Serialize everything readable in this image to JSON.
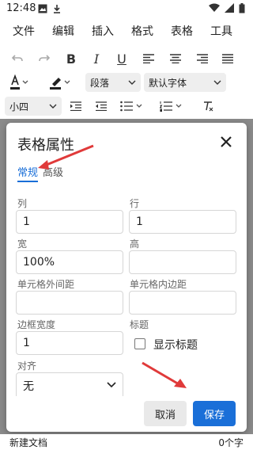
{
  "status": {
    "time": "12:48"
  },
  "menu": [
    "文件",
    "编辑",
    "插入",
    "格式",
    "表格",
    "工具"
  ],
  "toolbar": {
    "paragraph_select": "段落",
    "font_select": "默认字体",
    "size_select": "小四"
  },
  "dialog": {
    "title": "表格属性",
    "tabs": {
      "general": "常规",
      "advanced": "高级"
    },
    "labels": {
      "cols": "列",
      "rows": "行",
      "width": "宽",
      "height": "高",
      "cell_spacing": "单元格外间距",
      "cell_padding": "单元格内边距",
      "border_width": "边框宽度",
      "caption": "标题",
      "align": "对齐"
    },
    "values": {
      "cols": "1",
      "rows": "1",
      "width": "100%",
      "height": "",
      "cell_spacing": "",
      "cell_padding": "",
      "border_width": "1",
      "align": "无"
    },
    "caption_checkbox_label": "显示标题",
    "buttons": {
      "cancel": "取消",
      "save": "保存"
    }
  },
  "footer": {
    "doc_name": "新建文档",
    "word_count": "0个字"
  },
  "colors": {
    "accent": "#1a6fd8",
    "annotation_arrow": "#e03a3a"
  }
}
